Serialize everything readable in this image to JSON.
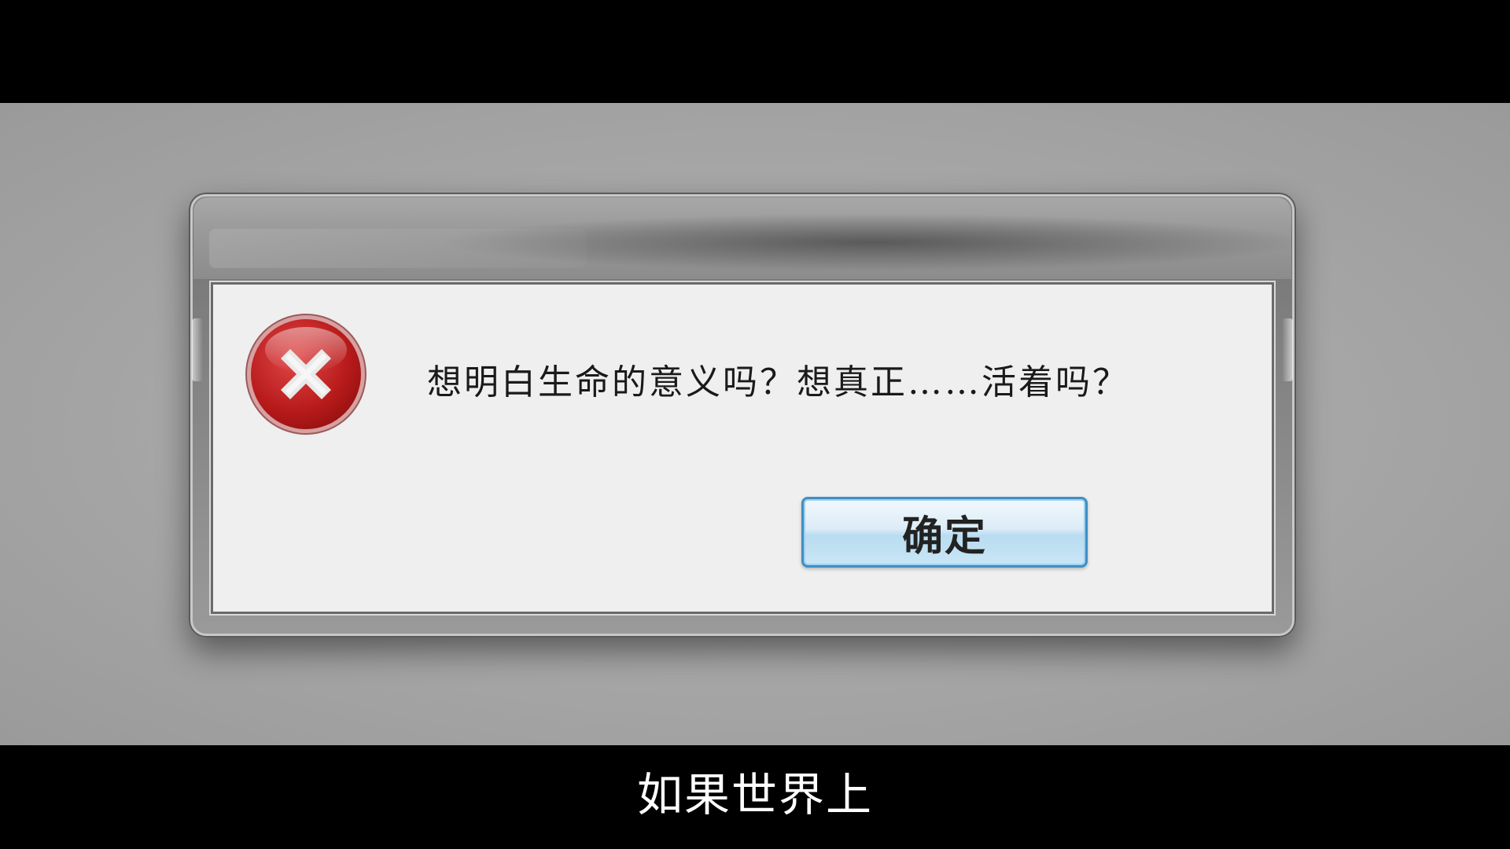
{
  "dialog": {
    "message": "想明白生命的意义吗？想真正……活着吗？",
    "ok_label": "确定",
    "icon": "error-x-icon"
  },
  "subtitle": "如果世界上",
  "colors": {
    "error_red": "#c41e1e",
    "button_border": "#3e8fc4",
    "background_gray": "#a6a6a6"
  }
}
